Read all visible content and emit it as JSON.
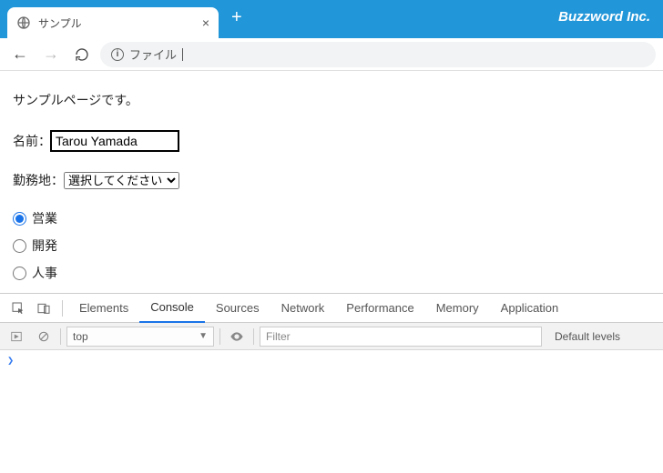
{
  "brand": "Buzzword Inc.",
  "tab": {
    "title": "サンプル"
  },
  "address": {
    "text": "ファイル"
  },
  "page": {
    "heading": "サンプルページです。",
    "name_label": "名前：",
    "name_value": "Tarou Yamada",
    "location_label": "勤務地：",
    "location_placeholder": "選択してください",
    "radios": [
      {
        "label": "営業",
        "checked": true
      },
      {
        "label": "開発",
        "checked": false
      },
      {
        "label": "人事",
        "checked": false
      }
    ]
  },
  "devtools": {
    "tabs": [
      "Elements",
      "Console",
      "Sources",
      "Network",
      "Performance",
      "Memory",
      "Application"
    ],
    "active_tab": "Console",
    "context": "top",
    "filter_placeholder": "Filter",
    "levels": "Default levels"
  }
}
